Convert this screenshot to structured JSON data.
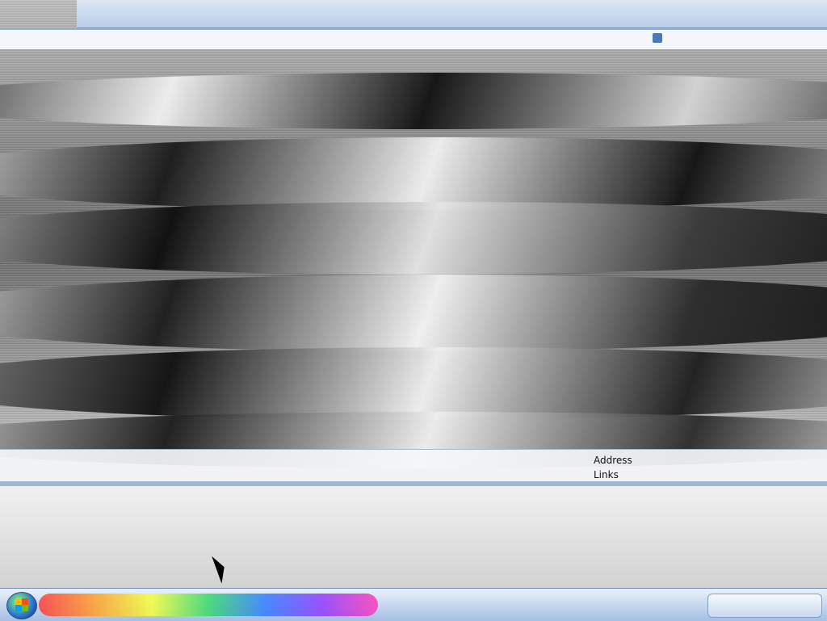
{
  "screen": {
    "bottom_panel": {
      "labels": [
        "Address",
        "Links"
      ]
    }
  }
}
